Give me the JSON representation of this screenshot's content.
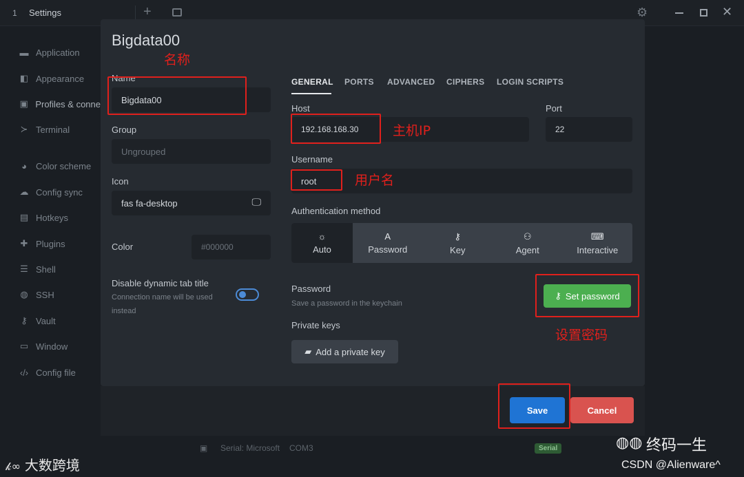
{
  "titlebar": {
    "tab_number": "1",
    "title": "Settings",
    "plus": "+",
    "close": "✕"
  },
  "sidebar": {
    "items": [
      {
        "label": "Application",
        "icon": "window-icon",
        "glyph": "▬"
      },
      {
        "label": "Appearance",
        "icon": "brush-icon",
        "glyph": "◧"
      },
      {
        "label": "Profiles & conne",
        "icon": "profiles-icon",
        "glyph": "▣"
      },
      {
        "label": "Terminal",
        "icon": "terminal-icon",
        "glyph": "≻"
      },
      {
        "label": "Color scheme",
        "icon": "palette-icon",
        "glyph": "◕"
      },
      {
        "label": "Config sync",
        "icon": "cloud-icon",
        "glyph": "☁"
      },
      {
        "label": "Hotkeys",
        "icon": "keyboard-icon",
        "glyph": "▤"
      },
      {
        "label": "Plugins",
        "icon": "puzzle-icon",
        "glyph": "✚"
      },
      {
        "label": "Shell",
        "icon": "list-icon",
        "glyph": "☰"
      },
      {
        "label": "SSH",
        "icon": "globe-icon",
        "glyph": "◍"
      },
      {
        "label": "Vault",
        "icon": "key-icon",
        "glyph": "⚷"
      },
      {
        "label": "Window",
        "icon": "window-icon",
        "glyph": "▭"
      },
      {
        "label": "Config file",
        "icon": "code-icon",
        "glyph": "‹/›"
      }
    ]
  },
  "modal": {
    "title": "Bigdata00",
    "name_label": "Name",
    "name_value": "Bigdata00",
    "group_label": "Group",
    "group_placeholder": "Ungrouped",
    "icon_label": "Icon",
    "icon_value": "fas fa-desktop",
    "color_label": "Color",
    "color_placeholder": "#000000",
    "dynamic_title_label": "Disable dynamic tab title",
    "dynamic_title_sub1": "Connection name will be used",
    "dynamic_title_sub2": "instead",
    "tabs": [
      "GENERAL",
      "PORTS",
      "ADVANCED",
      "CIPHERS",
      "LOGIN SCRIPTS"
    ],
    "host_label": "Host",
    "host_value": "192.168.168.30",
    "port_label": "Port",
    "port_value": "22",
    "username_label": "Username",
    "username_value": "root",
    "auth_label": "Authentication method",
    "auth_options": [
      {
        "label": "Auto",
        "glyph": "☼"
      },
      {
        "label": "Password",
        "glyph": "A"
      },
      {
        "label": "Key",
        "glyph": "⚷"
      },
      {
        "label": "Agent",
        "glyph": "⚇"
      },
      {
        "label": "Interactive",
        "glyph": "⌨"
      }
    ],
    "password_label": "Password",
    "password_sub": "Save a password in the keychain",
    "set_password": "Set password",
    "private_keys_label": "Private keys",
    "add_private_key": "Add a private key",
    "save": "Save",
    "cancel": "Cancel"
  },
  "background": {
    "serial_label": "Serial: Microsoft",
    "serial_port": "COM3",
    "serial_chip": "Serial"
  },
  "annotations": {
    "name": "名称",
    "host_ip": "主机IP",
    "username": "用户名",
    "set_password": "设置密码"
  },
  "watermarks": {
    "left": "大数跨境",
    "right": "终码一生",
    "csdn": "CSDN @Alienware^"
  },
  "colors": {
    "accent_blue": "#1f74d4",
    "success_green": "#4caf50",
    "danger_red": "#d9534f",
    "annotation_red": "#e0201c"
  }
}
